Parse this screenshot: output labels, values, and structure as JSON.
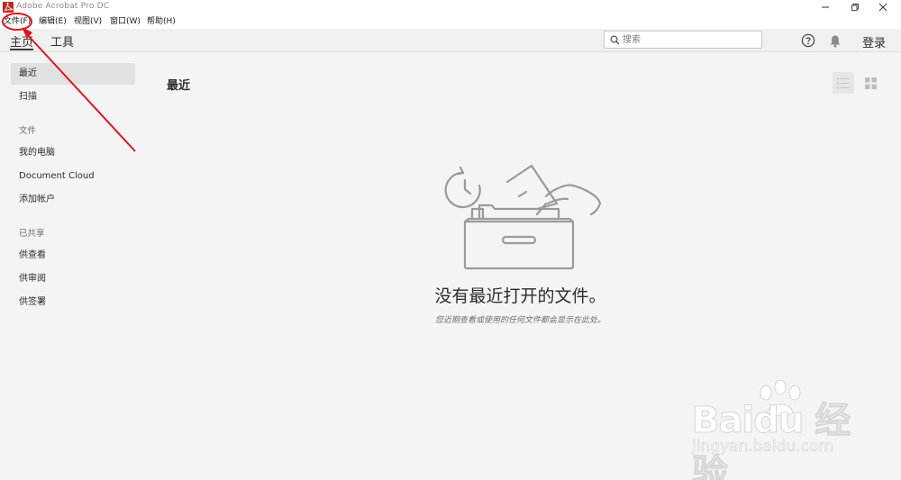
{
  "window": {
    "title": "Adobe Acrobat Pro DC",
    "icon": "acrobat-icon",
    "controls": [
      "minimize-icon",
      "restore-icon",
      "close-icon"
    ]
  },
  "menu": {
    "file": "文件(F)",
    "edit": "编辑(E)",
    "view": "视图(V)",
    "window": "窗口(W)",
    "help": "帮助(H)"
  },
  "tabs": {
    "home": "主页",
    "tools": "工具"
  },
  "search": {
    "placeholder": "搜索",
    "icon": "search-icon"
  },
  "header_icons": [
    "help-icon",
    "bell-icon"
  ],
  "login": "登录",
  "sidebar": {
    "recent": "最近",
    "scan": "扫描",
    "files_header": "文件",
    "my_computer": "我的电脑",
    "document_cloud": "Document Cloud",
    "add_account": "添加帐户",
    "shared_header": "已共享",
    "for_view": "供查看",
    "for_review": "供审阅",
    "for_sign": "供签署"
  },
  "main": {
    "title": "最近",
    "view_modes": [
      "list-view-icon",
      "grid-view-icon"
    ],
    "empty_title": "没有最近打开的文件。",
    "empty_subtitle": "您近期查看或使用的任何文件都会显示在此处。"
  },
  "watermark": {
    "brand": "Baidu 经验",
    "url": "jingyan.baidu.com"
  },
  "colors": {
    "brand_red": "#c7261f",
    "annotation_red": "#e0141e",
    "background": "#f4f4f4"
  }
}
